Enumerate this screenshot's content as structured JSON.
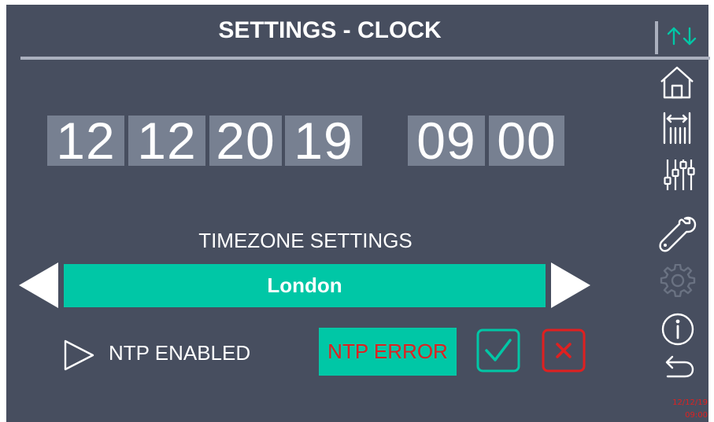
{
  "header": {
    "title": "SETTINGS - CLOCK"
  },
  "clock": {
    "day": "12",
    "month": "12",
    "century": "20",
    "year": "19",
    "hour": "09",
    "minute": "00"
  },
  "timezone": {
    "heading": "TIMEZONE SETTINGS",
    "selected": "London",
    "prev_icon": "triangle-left-icon",
    "next_icon": "triangle-right-icon"
  },
  "ntp": {
    "enabled_label": "NTP ENABLED",
    "toggle_icon": "play-outline-icon",
    "error_label": "NTP ERROR"
  },
  "actions": {
    "confirm_icon": "check-icon",
    "cancel_icon": "close-icon"
  },
  "sidebar": {
    "top_icon": "up-down-arrows-icon",
    "items": [
      {
        "icon": "home-icon",
        "enabled": true
      },
      {
        "icon": "range-bars-icon",
        "enabled": true
      },
      {
        "icon": "sliders-icon",
        "enabled": true
      },
      {
        "icon": "wrench-icon",
        "enabled": true
      },
      {
        "icon": "gear-icon",
        "enabled": false
      },
      {
        "icon": "info-icon",
        "enabled": true
      },
      {
        "icon": "back-arrow-icon",
        "enabled": true
      }
    ]
  },
  "status": {
    "date": "12/12/19",
    "time": "09:00"
  },
  "colors": {
    "background": "#474e5f",
    "digit_box": "#778091",
    "accent": "#00c7a6",
    "error": "#e02020",
    "text": "#ffffff",
    "disabled_icon": "#6a7282"
  }
}
